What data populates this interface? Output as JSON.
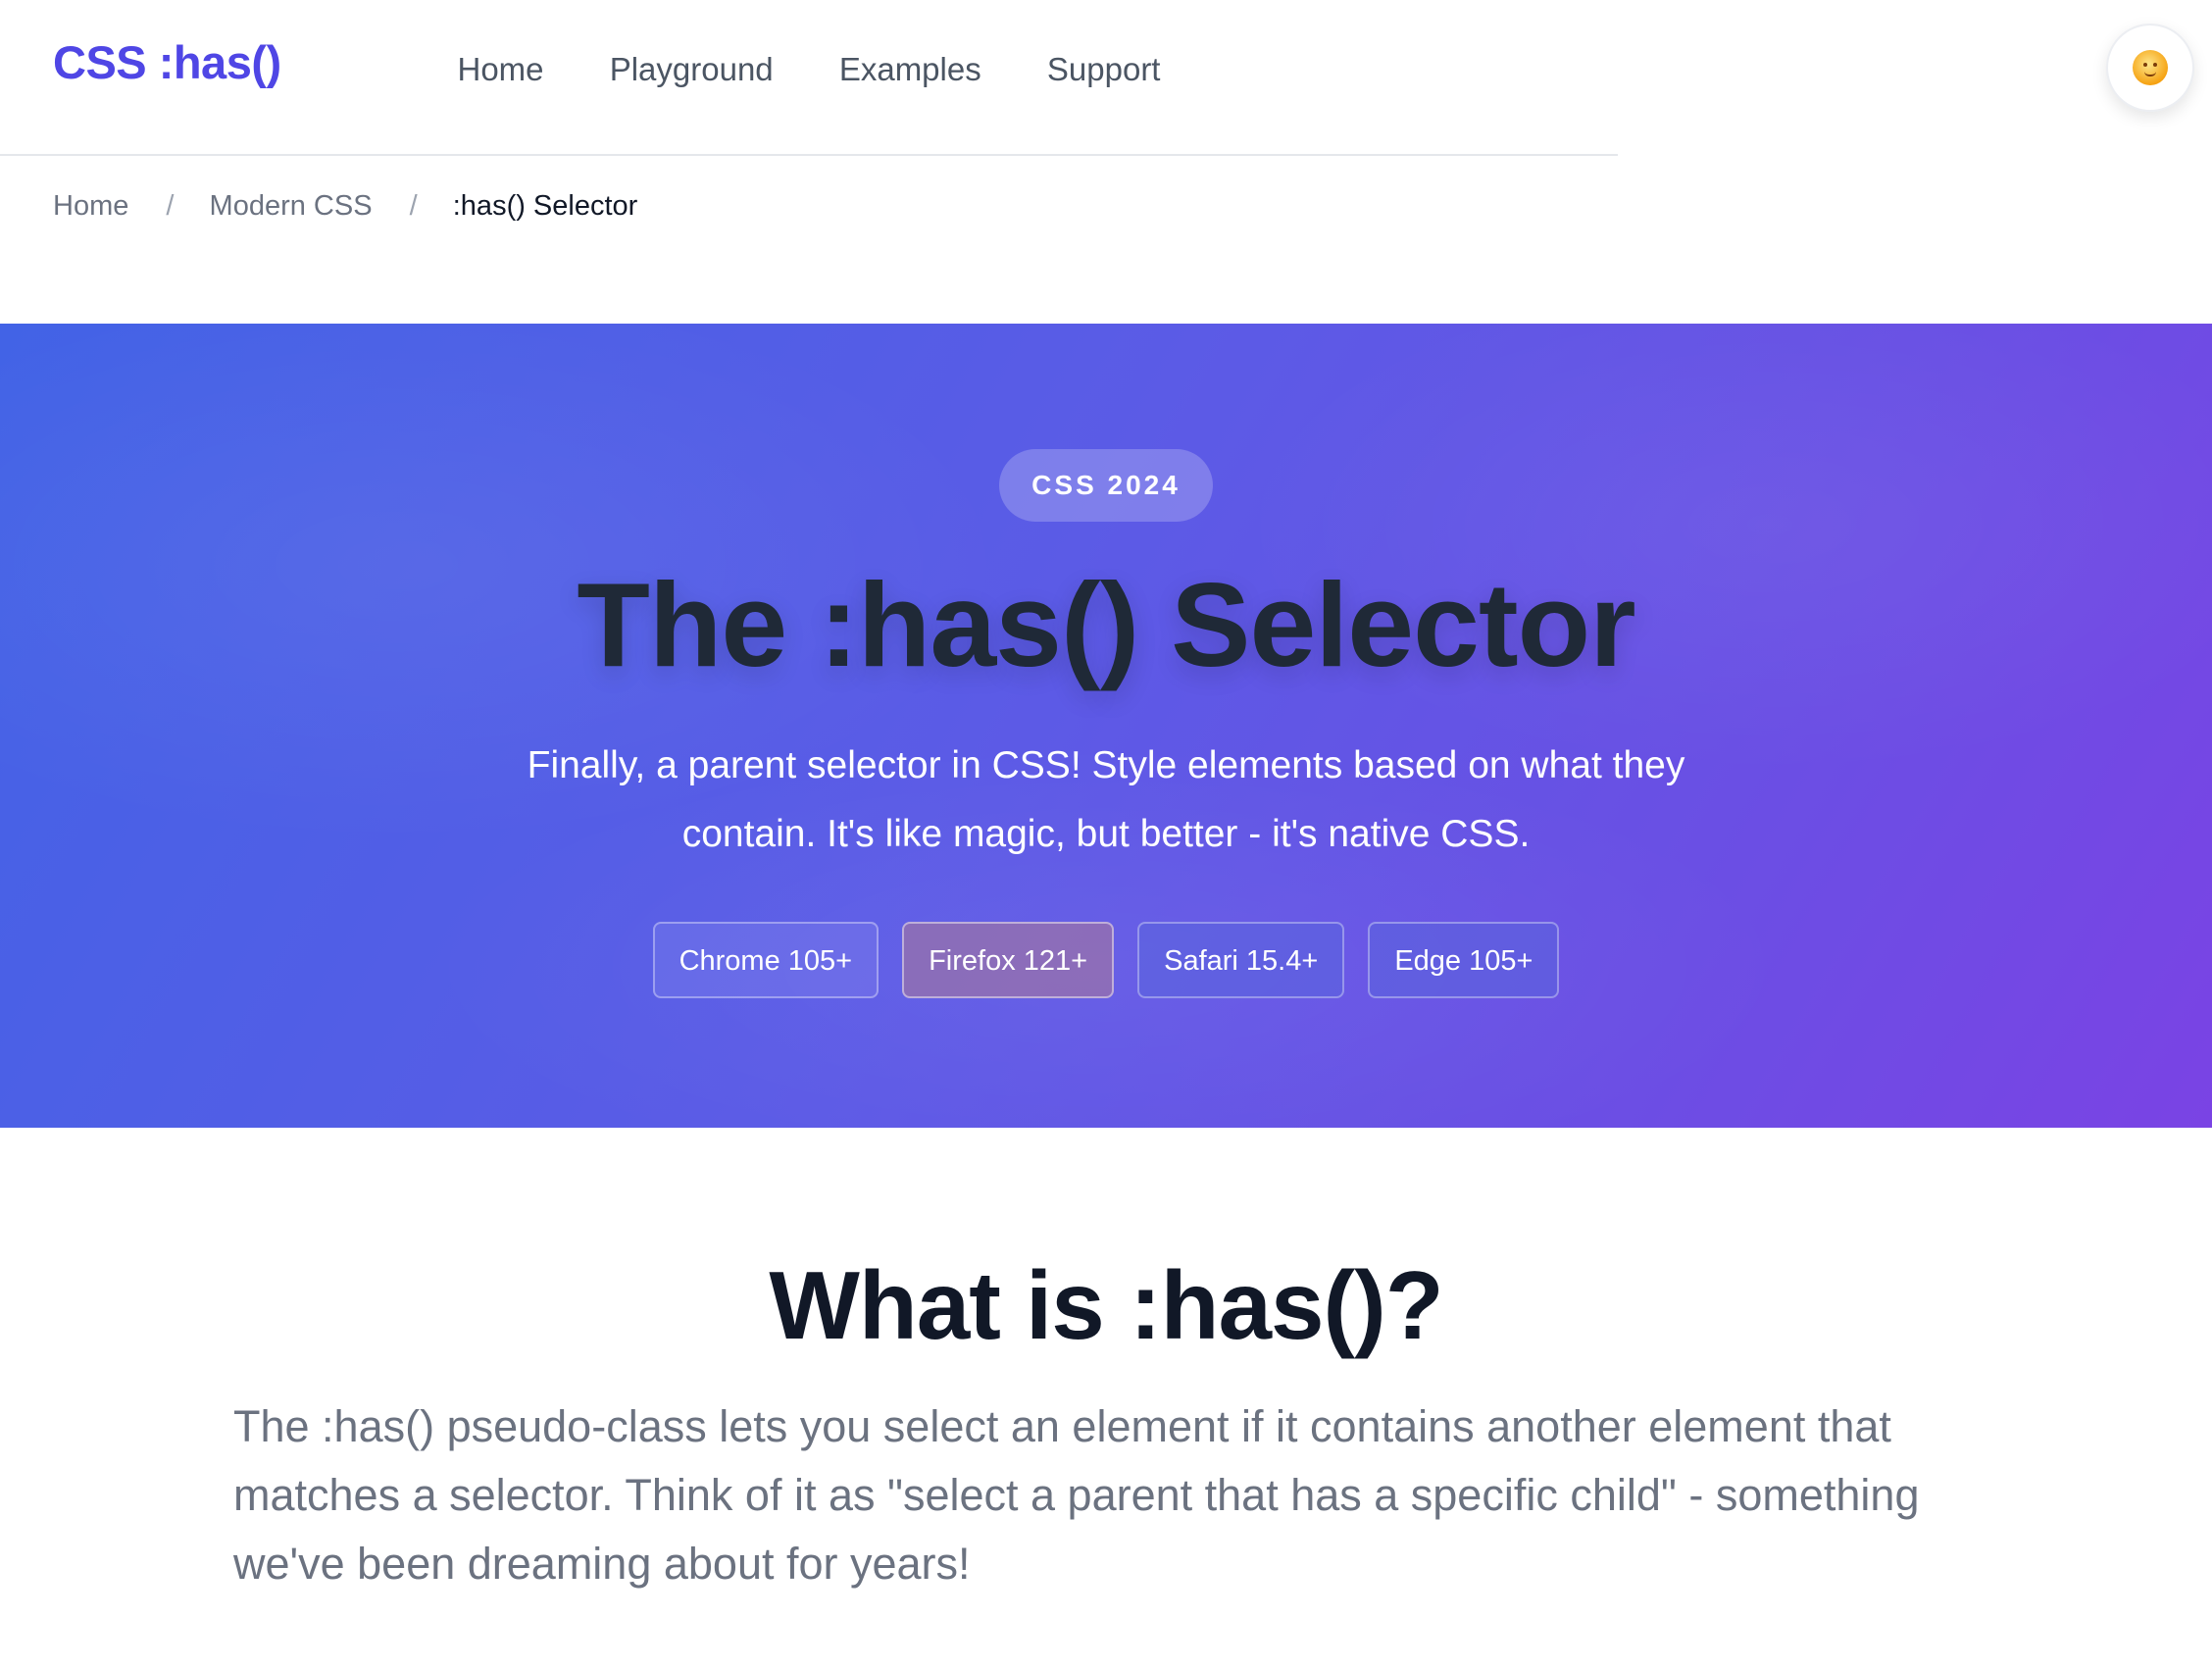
{
  "header": {
    "logo": "CSS :has()",
    "nav": [
      "Home",
      "Playground",
      "Examples",
      "Support"
    ],
    "theme_toggle_icon": "sun-icon"
  },
  "breadcrumb": {
    "items": [
      "Home",
      "Modern CSS"
    ],
    "current": ":has() Selector",
    "separator": "/"
  },
  "hero": {
    "badge": "CSS 2024",
    "title": "The :has() Selector",
    "subtitle": "Finally, a parent selector in CSS! Style elements based on what they contain. It's like magic, but better - it's native CSS.",
    "browsers": [
      "Chrome 105+",
      "Firefox 121+",
      "Safari 15.4+",
      "Edge 105+"
    ],
    "gradient_colors": [
      "#4263e6",
      "#7a43e4"
    ]
  },
  "intro": {
    "title": "What is :has()?",
    "body": "The :has() pseudo-class lets you select an element if it contains another element that matches a selector. Think of it as \"select a parent that has a specific child\" - something we've been dreaming about for years!"
  },
  "colors": {
    "brand": "#4f46e5",
    "text_dark": "#111827",
    "text_muted": "#6b7280"
  }
}
